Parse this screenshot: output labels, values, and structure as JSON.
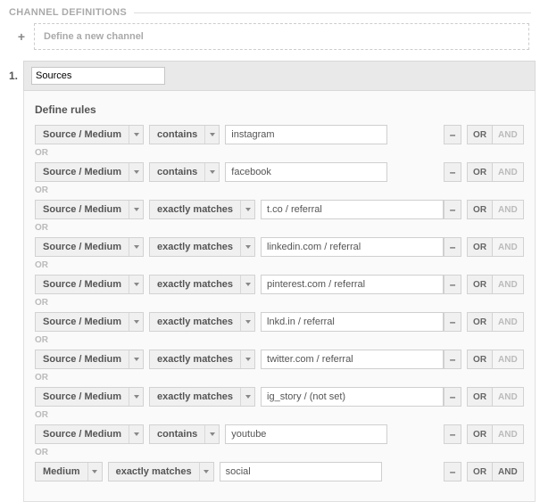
{
  "section_title": "CHANNEL DEFINITIONS",
  "plus_symbol": "+",
  "new_channel_placeholder": "Define a new channel",
  "channel_number": "1.",
  "channel_name": "Sources",
  "rules_heading": "Define rules",
  "labels": {
    "source_medium": "Source / Medium",
    "medium": "Medium",
    "contains": "contains",
    "exactly_matches": "exactly matches",
    "minus": "–",
    "or": "OR",
    "and": "AND",
    "sep_or": "OR"
  },
  "rules": [
    {
      "field": "Source / Medium",
      "op": "contains",
      "val": "instagram",
      "w": "w1",
      "and_enabled": false
    },
    {
      "field": "Source / Medium",
      "op": "contains",
      "val": "facebook",
      "w": "w1",
      "and_enabled": false
    },
    {
      "field": "Source / Medium",
      "op": "exactly matches",
      "val": "t.co / referral",
      "w": "w2",
      "and_enabled": false
    },
    {
      "field": "Source / Medium",
      "op": "exactly matches",
      "val": "linkedin.com / referral",
      "w": "w2",
      "and_enabled": false
    },
    {
      "field": "Source / Medium",
      "op": "exactly matches",
      "val": "pinterest.com / referral",
      "w": "w2",
      "and_enabled": false
    },
    {
      "field": "Source / Medium",
      "op": "exactly matches",
      "val": "lnkd.in / referral",
      "w": "w2",
      "and_enabled": false
    },
    {
      "field": "Source / Medium",
      "op": "exactly matches",
      "val": "twitter.com / referral",
      "w": "w2",
      "and_enabled": false
    },
    {
      "field": "Source / Medium",
      "op": "exactly matches",
      "val": "ig_story / (not set)",
      "w": "w2",
      "and_enabled": false
    },
    {
      "field": "Source / Medium",
      "op": "contains",
      "val": "youtube",
      "w": "w1",
      "and_enabled": false
    },
    {
      "field": "Medium",
      "op": "exactly matches",
      "val": "social",
      "w": "w1",
      "and_enabled": true
    }
  ]
}
